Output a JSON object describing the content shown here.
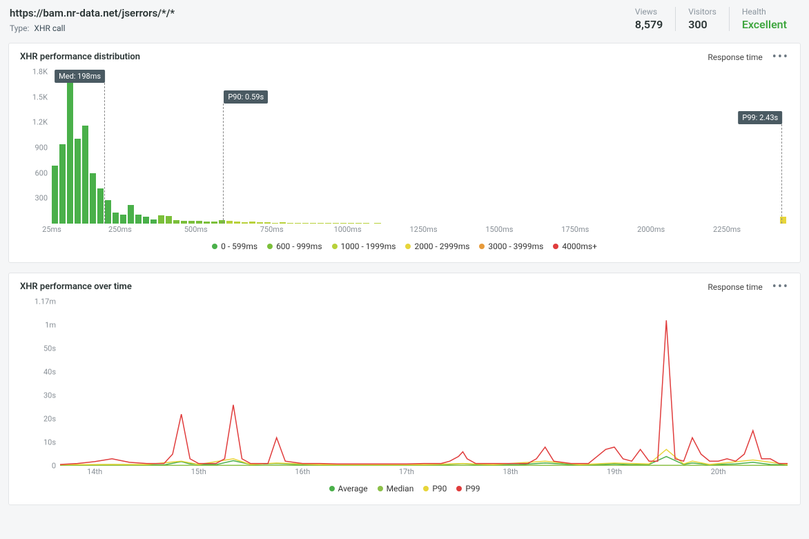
{
  "header": {
    "title": "https://bam.nr-data.net/jserrors/*/*",
    "type_label": "Type:",
    "type_value": "XHR call",
    "stats": [
      {
        "label": "Views",
        "value": "8,579",
        "cls": ""
      },
      {
        "label": "Visitors",
        "value": "300",
        "cls": ""
      },
      {
        "label": "Health",
        "value": "Excellent",
        "cls": "excellent"
      }
    ]
  },
  "panel1": {
    "title": "XHR performance distribution",
    "right_label": "Response time",
    "y_ticks": [
      "1.8K",
      "1.5K",
      "1.2K",
      "900",
      "600",
      "300"
    ],
    "x_ticks": [
      "25ms",
      "250ms",
      "500ms",
      "750ms",
      "1000ms",
      "1250ms",
      "1500ms",
      "1750ms",
      "2000ms",
      "2250ms"
    ],
    "markers": {
      "med": "Med: 198ms",
      "p90": "P90: 0.59s",
      "p99": "P99: 2.43s"
    },
    "legend": [
      {
        "label": "0 - 599ms",
        "color": "#4ab04a"
      },
      {
        "label": "600 - 999ms",
        "color": "#7bbf3a"
      },
      {
        "label": "1000 - 1999ms",
        "color": "#b8d13a"
      },
      {
        "label": "2000 - 2999ms",
        "color": "#e7d53a"
      },
      {
        "label": "3000 - 3999ms",
        "color": "#e79a3a"
      },
      {
        "label": "4000ms+",
        "color": "#e03c3c"
      }
    ]
  },
  "panel2": {
    "title": "XHR performance over time",
    "right_label": "Response time",
    "y_ticks": [
      "1.17m",
      "1m",
      "50s",
      "40s",
      "30s",
      "20s",
      "10s",
      "0"
    ],
    "x_ticks": [
      "14th",
      "15th",
      "16th",
      "17th",
      "18th",
      "19th",
      "20th"
    ],
    "legend": [
      {
        "label": "Average",
        "color": "#4ab04a"
      },
      {
        "label": "Median",
        "color": "#8cc048"
      },
      {
        "label": "P90",
        "color": "#e7d53a"
      },
      {
        "label": "P99",
        "color": "#e03c3c"
      }
    ]
  },
  "chart_data": [
    {
      "type": "bar",
      "title": "XHR performance distribution",
      "xlabel": "",
      "ylabel": "",
      "ylim": [
        0,
        1800
      ],
      "x_axis_start_ms": 25,
      "bin_width_ms": 25,
      "color_key": "legend index",
      "bars": [
        {
          "mid_ms": 37.5,
          "count": 690,
          "color": 0
        },
        {
          "mid_ms": 62.5,
          "count": 940,
          "color": 0
        },
        {
          "mid_ms": 87.5,
          "count": 1730,
          "color": 0
        },
        {
          "mid_ms": 112.5,
          "count": 1010,
          "color": 0
        },
        {
          "mid_ms": 137.5,
          "count": 1160,
          "color": 0
        },
        {
          "mid_ms": 162.5,
          "count": 600,
          "color": 0
        },
        {
          "mid_ms": 187.5,
          "count": 415,
          "color": 0
        },
        {
          "mid_ms": 212.5,
          "count": 280,
          "color": 0
        },
        {
          "mid_ms": 237.5,
          "count": 130,
          "color": 0
        },
        {
          "mid_ms": 262.5,
          "count": 110,
          "color": 0
        },
        {
          "mid_ms": 287.5,
          "count": 220,
          "color": 0
        },
        {
          "mid_ms": 312.5,
          "count": 110,
          "color": 0
        },
        {
          "mid_ms": 337.5,
          "count": 80,
          "color": 0
        },
        {
          "mid_ms": 362.5,
          "count": 50,
          "color": 0
        },
        {
          "mid_ms": 387.5,
          "count": 95,
          "color": 1
        },
        {
          "mid_ms": 412.5,
          "count": 90,
          "color": 1
        },
        {
          "mid_ms": 437.5,
          "count": 40,
          "color": 1
        },
        {
          "mid_ms": 462.5,
          "count": 35,
          "color": 1
        },
        {
          "mid_ms": 487.5,
          "count": 30,
          "color": 1
        },
        {
          "mid_ms": 512.5,
          "count": 32,
          "color": 1
        },
        {
          "mid_ms": 537.5,
          "count": 28,
          "color": 1
        },
        {
          "mid_ms": 562.5,
          "count": 26,
          "color": 1
        },
        {
          "mid_ms": 587.5,
          "count": 38,
          "color": 1
        },
        {
          "mid_ms": 612.5,
          "count": 30,
          "color": 2
        },
        {
          "mid_ms": 637.5,
          "count": 22,
          "color": 2
        },
        {
          "mid_ms": 662.5,
          "count": 20,
          "color": 2
        },
        {
          "mid_ms": 687.5,
          "count": 22,
          "color": 2
        },
        {
          "mid_ms": 712.5,
          "count": 16,
          "color": 2
        },
        {
          "mid_ms": 737.5,
          "count": 16,
          "color": 2
        },
        {
          "mid_ms": 762.5,
          "count": 12,
          "color": 2
        },
        {
          "mid_ms": 787.5,
          "count": 14,
          "color": 2
        },
        {
          "mid_ms": 812.5,
          "count": 10,
          "color": 2
        },
        {
          "mid_ms": 837.5,
          "count": 8,
          "color": 2
        },
        {
          "mid_ms": 862.5,
          "count": 6,
          "color": 2
        },
        {
          "mid_ms": 887.5,
          "count": 4,
          "color": 2
        },
        {
          "mid_ms": 912.5,
          "count": 4,
          "color": 2
        },
        {
          "mid_ms": 937.5,
          "count": 4,
          "color": 2
        },
        {
          "mid_ms": 962.5,
          "count": 4,
          "color": 2
        },
        {
          "mid_ms": 987.5,
          "count": 2,
          "color": 2
        },
        {
          "mid_ms": 1012.5,
          "count": 2,
          "color": 2
        },
        {
          "mid_ms": 1037.5,
          "count": 2,
          "color": 2
        },
        {
          "mid_ms": 1062.5,
          "count": 2,
          "color": 2
        },
        {
          "mid_ms": 1100,
          "count": 1,
          "color": 2
        },
        {
          "mid_ms": 2437.5,
          "count": 80,
          "color": 3
        }
      ],
      "markers": [
        {
          "name": "Med",
          "at_ms": 198
        },
        {
          "name": "P90",
          "at_ms": 590
        },
        {
          "name": "P99",
          "at_ms": 2430
        }
      ]
    },
    {
      "type": "line",
      "title": "XHR performance over time",
      "xlabel": "",
      "ylabel": "",
      "x_unit": "hour index (0 = start of day 14)",
      "y_unit": "seconds",
      "x_range": [
        0,
        168
      ],
      "y_range": [
        0,
        70
      ],
      "series": [
        {
          "name": "Average",
          "color": "#4ab04a",
          "points": [
            [
              0,
              0.4
            ],
            [
              6,
              0.5
            ],
            [
              12,
              0.6
            ],
            [
              18,
              0.5
            ],
            [
              24,
              0.4
            ],
            [
              28,
              1.8
            ],
            [
              30,
              0.8
            ],
            [
              36,
              0.5
            ],
            [
              40,
              2.2
            ],
            [
              44,
              0.6
            ],
            [
              50,
              1.0
            ],
            [
              56,
              0.5
            ],
            [
              64,
              0.4
            ],
            [
              72,
              0.4
            ],
            [
              80,
              0.4
            ],
            [
              88,
              0.5
            ],
            [
              93,
              0.9
            ],
            [
              98,
              0.4
            ],
            [
              106,
              0.5
            ],
            [
              112,
              1.2
            ],
            [
              118,
              0.6
            ],
            [
              124,
              0.5
            ],
            [
              128,
              0.8
            ],
            [
              132,
              0.5
            ],
            [
              136,
              0.6
            ],
            [
              140,
              4.0
            ],
            [
              144,
              0.6
            ],
            [
              146,
              1.2
            ],
            [
              150,
              0.5
            ],
            [
              156,
              0.8
            ],
            [
              160,
              1.5
            ],
            [
              164,
              0.6
            ],
            [
              168,
              0.5
            ]
          ]
        },
        {
          "name": "Median",
          "color": "#8cc048",
          "points": [
            [
              0,
              0.2
            ],
            [
              24,
              0.2
            ],
            [
              48,
              0.2
            ],
            [
              72,
              0.2
            ],
            [
              96,
              0.2
            ],
            [
              120,
              0.2
            ],
            [
              144,
              0.2
            ],
            [
              168,
              0.2
            ]
          ]
        },
        {
          "name": "P90",
          "color": "#e7d53a",
          "points": [
            [
              0,
              0.5
            ],
            [
              10,
              0.6
            ],
            [
              20,
              0.6
            ],
            [
              28,
              2.0
            ],
            [
              32,
              0.6
            ],
            [
              40,
              3.0
            ],
            [
              44,
              0.6
            ],
            [
              50,
              1.2
            ],
            [
              60,
              0.5
            ],
            [
              72,
              0.5
            ],
            [
              84,
              0.5
            ],
            [
              93,
              1.0
            ],
            [
              100,
              0.5
            ],
            [
              112,
              2.0
            ],
            [
              120,
              0.5
            ],
            [
              128,
              1.2
            ],
            [
              136,
              0.8
            ],
            [
              140,
              7.0
            ],
            [
              144,
              0.8
            ],
            [
              146,
              2.0
            ],
            [
              150,
              0.6
            ],
            [
              160,
              2.5
            ],
            [
              168,
              0.6
            ]
          ]
        },
        {
          "name": "P99",
          "color": "#e03c3c",
          "points": [
            [
              0,
              0.6
            ],
            [
              4,
              1.0
            ],
            [
              8,
              1.8
            ],
            [
              12,
              3.0
            ],
            [
              16,
              1.5
            ],
            [
              20,
              1.0
            ],
            [
              24,
              1.0
            ],
            [
              26,
              5.0
            ],
            [
              28,
              22.0
            ],
            [
              30,
              3.0
            ],
            [
              32,
              1.0
            ],
            [
              36,
              1.0
            ],
            [
              38,
              3.0
            ],
            [
              40,
              26.0
            ],
            [
              42,
              3.0
            ],
            [
              44,
              1.0
            ],
            [
              48,
              1.0
            ],
            [
              50,
              12.0
            ],
            [
              52,
              2.0
            ],
            [
              56,
              1.0
            ],
            [
              60,
              1.0
            ],
            [
              64,
              0.8
            ],
            [
              68,
              0.8
            ],
            [
              72,
              0.8
            ],
            [
              76,
              0.8
            ],
            [
              80,
              0.8
            ],
            [
              84,
              1.0
            ],
            [
              88,
              1.0
            ],
            [
              90,
              2.0
            ],
            [
              92,
              4.0
            ],
            [
              93,
              6.0
            ],
            [
              94,
              3.0
            ],
            [
              96,
              1.0
            ],
            [
              100,
              1.0
            ],
            [
              104,
              1.0
            ],
            [
              108,
              1.0
            ],
            [
              110,
              3.0
            ],
            [
              112,
              8.0
            ],
            [
              114,
              2.0
            ],
            [
              118,
              1.0
            ],
            [
              122,
              1.0
            ],
            [
              124,
              4.0
            ],
            [
              126,
              7.0
            ],
            [
              128,
              8.0
            ],
            [
              130,
              3.0
            ],
            [
              132,
              2.0
            ],
            [
              134,
              7.0
            ],
            [
              136,
              2.0
            ],
            [
              138,
              2.0
            ],
            [
              140,
              62.0
            ],
            [
              142,
              3.0
            ],
            [
              144,
              2.0
            ],
            [
              146,
              12.0
            ],
            [
              148,
              5.0
            ],
            [
              150,
              2.0
            ],
            [
              152,
              2.0
            ],
            [
              154,
              3.0
            ],
            [
              156,
              2.0
            ],
            [
              158,
              5.0
            ],
            [
              160,
              15.0
            ],
            [
              162,
              3.0
            ],
            [
              164,
              3.0
            ],
            [
              166,
              1.0
            ],
            [
              168,
              1.0
            ]
          ]
        }
      ]
    }
  ]
}
